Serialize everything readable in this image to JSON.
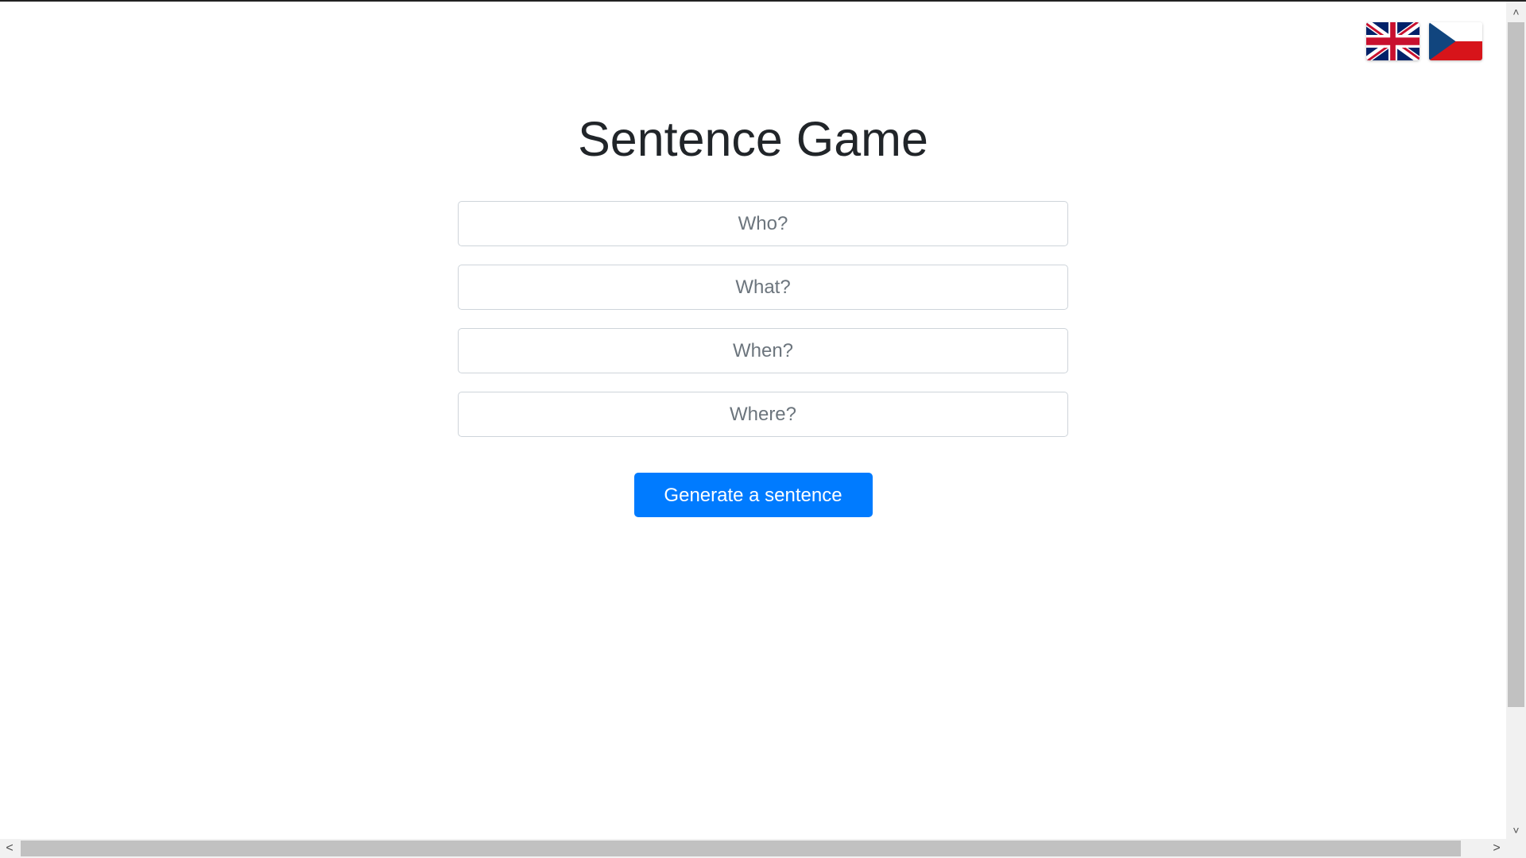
{
  "header": {
    "title": "Sentence Game"
  },
  "language_switch": {
    "english_flag": "uk-flag-icon",
    "czech_flag": "czech-flag-icon"
  },
  "form": {
    "who_placeholder": "Who?",
    "what_placeholder": "What?",
    "when_placeholder": "When?",
    "where_placeholder": "Where?",
    "who_value": "",
    "what_value": "",
    "when_value": "",
    "where_value": ""
  },
  "actions": {
    "generate_label": "Generate a sentence"
  },
  "scrollbars": {
    "up_arrow": "˄",
    "down_arrow": "˅",
    "left_arrow": "<",
    "right_arrow": ">"
  },
  "colors": {
    "accent": "#007bff",
    "title_text": "#212529",
    "placeholder": "#6c757d",
    "border": "#ced4da"
  }
}
